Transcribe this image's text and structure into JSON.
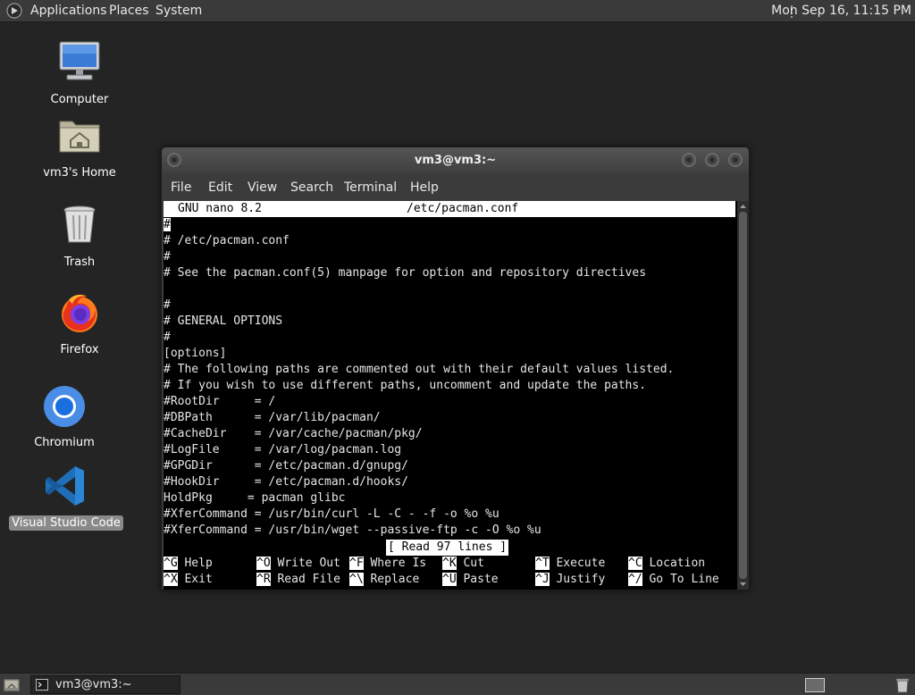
{
  "top_panel": {
    "menus": [
      "Applications",
      "Places",
      "System"
    ],
    "clock": "Mon Sep 16, 11:15 PM"
  },
  "desktop_icons": [
    {
      "label": "Computer",
      "icon": "computer-icon"
    },
    {
      "label": "vm3's Home",
      "icon": "home-folder-icon"
    },
    {
      "label": "Trash",
      "icon": "trash-icon"
    },
    {
      "label": "Firefox",
      "icon": "firefox-icon"
    },
    {
      "label": "Chromium",
      "icon": "chromium-icon"
    },
    {
      "label": "Visual Studio Code",
      "icon": "vscode-icon",
      "selected": true
    }
  ],
  "window": {
    "title": "vm3@vm3:~",
    "menus": [
      "File",
      "Edit",
      "View",
      "Search",
      "Terminal",
      "Help"
    ]
  },
  "nano": {
    "version": "GNU nano 8.2",
    "filename": "/etc/pacman.conf",
    "cursor_char": "#",
    "lines": [
      "# /etc/pacman.conf",
      "#",
      "# See the pacman.conf(5) manpage for option and repository directives",
      "",
      "#",
      "# GENERAL OPTIONS",
      "#",
      "[options]",
      "# The following paths are commented out with their default values listed.",
      "# If you wish to use different paths, uncomment and update the paths.",
      "#RootDir     = /",
      "#DBPath      = /var/lib/pacman/",
      "#CacheDir    = /var/cache/pacman/pkg/",
      "#LogFile     = /var/log/pacman.log",
      "#GPGDir      = /etc/pacman.d/gnupg/",
      "#HookDir     = /etc/pacman.d/hooks/",
      "HoldPkg     = pacman glibc",
      "#XferCommand = /usr/bin/curl -L -C - -f -o %o %u",
      "#XferCommand = /usr/bin/wget --passive-ftp -c -O %o %u"
    ],
    "status": "[ Read 97 lines ]",
    "shortcuts": [
      [
        {
          "key": "^G",
          "label": "Help"
        },
        {
          "key": "^O",
          "label": "Write Out"
        },
        {
          "key": "^F",
          "label": "Where Is"
        },
        {
          "key": "^K",
          "label": "Cut"
        },
        {
          "key": "^T",
          "label": "Execute"
        },
        {
          "key": "^C",
          "label": "Location"
        }
      ],
      [
        {
          "key": "^X",
          "label": "Exit"
        },
        {
          "key": "^R",
          "label": "Read File"
        },
        {
          "key": "^\\",
          "label": "Replace"
        },
        {
          "key": "^U",
          "label": "Paste"
        },
        {
          "key": "^J",
          "label": "Justify"
        },
        {
          "key": "^/",
          "label": "Go To Line"
        }
      ]
    ]
  },
  "taskbar": {
    "items": [
      {
        "label": "vm3@vm3:~",
        "icon": "terminal-icon"
      }
    ]
  },
  "colors": {
    "desktop_bg": "#242424",
    "panel_bg": "#3a3a3a",
    "terminal_bg": "#000000",
    "terminal_fg": "#e6e6e6",
    "selection_bg": "#8a8a8a"
  }
}
